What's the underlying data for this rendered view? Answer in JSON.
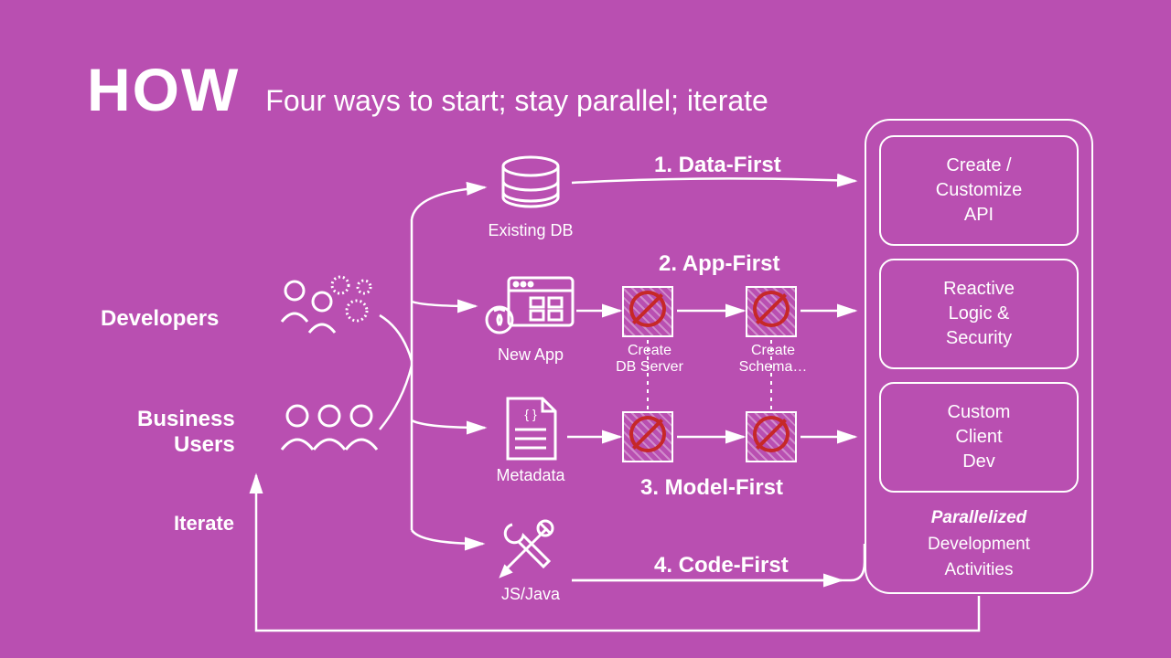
{
  "title": {
    "big": "HOW",
    "sub": "Four ways to start; stay parallel; iterate"
  },
  "roles": {
    "dev": "Developers",
    "biz": "Business\nUsers"
  },
  "iterate": "Iterate",
  "nodes": {
    "existing_db": "Existing DB",
    "new_app": "New App",
    "metadata": "Metadata",
    "jsjava": "JS/Java"
  },
  "paths": {
    "p1": "1. Data-First",
    "p2": "2. App-First",
    "p3": "3. Model-First",
    "p4": "4. Code-First"
  },
  "strikes": {
    "db_server": "Create\nDB Server",
    "schema": "Create\nSchema…"
  },
  "right": {
    "box1": "Create /\nCustomize\nAPI",
    "box2": "Reactive\nLogic &\nSecurity",
    "box3": "Custom\nClient\nDev",
    "footer_em": "Parallelized",
    "footer_rest": "Development\nActivities"
  }
}
